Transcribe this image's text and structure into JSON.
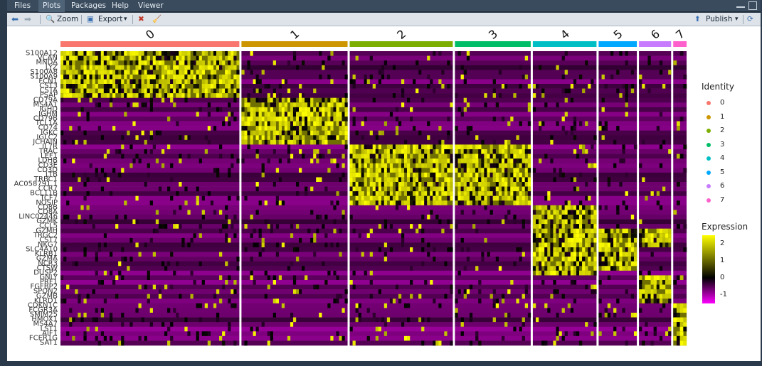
{
  "tabs": [
    {
      "label": "Files",
      "active": false
    },
    {
      "label": "Plots",
      "active": true
    },
    {
      "label": "Packages",
      "active": false
    },
    {
      "label": "Help",
      "active": false
    },
    {
      "label": "Viewer",
      "active": false
    }
  ],
  "toolbar": {
    "zoom_label": "Zoom",
    "export_label": "Export",
    "publish_label": "Publish",
    "export_dropdown": "▾",
    "publish_dropdown": "▾"
  },
  "chart_data": {
    "type": "heatmap",
    "clusters": [
      "0",
      "1",
      "2",
      "3",
      "4",
      "5",
      "6",
      "7"
    ],
    "cluster_colors": [
      "#f8766d",
      "#cd9600",
      "#7cae00",
      "#00be67",
      "#00bfc4",
      "#00a9ff",
      "#c77cff",
      "#ff61cc"
    ],
    "genes": [
      "S100A12",
      "VCAN",
      "MNDA",
      "LYZ",
      "S100A8",
      "S100A9",
      "FCN1",
      "CST3",
      "CSTA",
      "PSAP",
      "CD79A",
      "MS4A1",
      "IGHD",
      "IGHM",
      "CD79B",
      "TCL1A",
      "CD74",
      "IGKC",
      "IGLC2",
      "JCHAIN",
      "IL7R",
      "TRAC",
      "LEF1",
      "LDHB",
      "CD3E",
      "CD3D",
      "LTB",
      "TRBC1",
      "AC058791.1",
      "CCR7",
      "BCL11B",
      "TCF7",
      "NOSIP",
      "CD8B",
      "CD8A",
      "LINC02446",
      "GZMK",
      "CCL5",
      "GZMH",
      "TRGC2",
      "CST7",
      "NKG7",
      "SLC4A10",
      "KLRB1",
      "GZMA",
      "NCR3",
      "CTSW",
      "DUSP2",
      "GNLY",
      "PRF1",
      "FGFBP2",
      "SPON2",
      "GZMB",
      "KLRD1",
      "CDKN1C",
      "FCGR3A",
      "SMIM25",
      "HMOX1",
      "MS4A7",
      "LST1",
      "AIF1",
      "FCER1G",
      "SAT1"
    ],
    "gene_labels_shown": [
      "S100A12",
      "VCAN",
      "MNDA",
      "LYZ",
      "S100A8",
      "S100A9",
      "FCN1",
      "CST3",
      "CSTA",
      "PSAP",
      "CD79A",
      "MS4A1",
      "IGHD",
      "IGHM",
      "CD79B",
      "TCL1A",
      "CD74",
      "IGKC",
      "IGLC2",
      "JCHAIN",
      "IL7R",
      "TRAC",
      "LEF1",
      "LDHB",
      "CD3E",
      "CD3D",
      "LTB",
      "TRBC1",
      "AC058791.1",
      "CCR7",
      "BCL11B",
      "TCF7",
      "NOSIP",
      "CD8B",
      "CD8A",
      "LINC02446",
      "GZMK",
      "CCL5",
      "GZMH",
      "TRGC2",
      "CST7",
      "NKG7",
      "SLC4A10",
      "KLRB1",
      "GZMA",
      "NCR3",
      "CTSW",
      "DUSP2",
      "GNLY",
      "PRF1",
      "FGFBP2",
      "SPON2",
      "GZMB",
      "KLRD1",
      "CDKN1C",
      "FCGR3A",
      "SMIM25",
      "HMOX1",
      "MS4A7",
      "LST1",
      "AIF1",
      "FCER1G",
      "SAT1"
    ],
    "cluster_cell_fraction": [
      0.295,
      0.175,
      0.17,
      0.125,
      0.105,
      0.063,
      0.053,
      0.022
    ],
    "high_expression_blocks": [
      {
        "cluster": "0",
        "genes": [
          "S100A12",
          "VCAN",
          "MNDA",
          "LYZ",
          "S100A8",
          "S100A9",
          "FCN1",
          "CST3",
          "CSTA",
          "PSAP"
        ]
      },
      {
        "cluster": "1",
        "genes": [
          "CD79A",
          "MS4A1",
          "IGHD",
          "IGHM",
          "CD79B",
          "TCL1A",
          "CD74",
          "IGKC",
          "IGLC2",
          "JCHAIN"
        ]
      },
      {
        "cluster": "2",
        "genes": [
          "IL7R",
          "TRAC",
          "LEF1",
          "LDHB",
          "CD3E",
          "CD3D",
          "LTB",
          "TRBC1",
          "AC058791.1",
          "CCR7",
          "BCL11B",
          "TCF7",
          "NOSIP"
        ]
      },
      {
        "cluster": "3",
        "genes": [
          "IL7R",
          "TRAC",
          "LEF1",
          "LDHB",
          "CD3E",
          "CD3D",
          "LTB",
          "TRBC1",
          "AC058791.1",
          "CCR7",
          "BCL11B",
          "TCF7",
          "NOSIP"
        ]
      },
      {
        "cluster": "4",
        "genes": [
          "CD8B",
          "CD8A",
          "LINC02446",
          "GZMK",
          "CCL5",
          "GZMH",
          "TRGC2",
          "CST7",
          "NKG7",
          "SLC4A10",
          "KLRB1",
          "GZMA",
          "NCR3",
          "CTSW",
          "DUSP2"
        ]
      },
      {
        "cluster": "5",
        "genes": [
          "GZMH",
          "TRGC2",
          "CST7",
          "NKG7",
          "SLC4A10",
          "KLRB1",
          "GZMA",
          "NCR3",
          "CTSW"
        ]
      },
      {
        "cluster": "6",
        "genes": [
          "GZMH",
          "TRGC2",
          "CST7",
          "NKG7",
          "GNLY",
          "PRF1",
          "FGFBP2",
          "SPON2",
          "GZMB",
          "KLRD1"
        ]
      },
      {
        "cluster": "7",
        "genes": [
          "CDKN1C",
          "FCGR3A",
          "SMIM25",
          "HMOX1",
          "MS4A7",
          "LST1",
          "AIF1",
          "FCER1G",
          "SAT1"
        ]
      }
    ],
    "legend": {
      "identity_title": "Identity",
      "identity_labels": [
        "0",
        "1",
        "2",
        "3",
        "4",
        "5",
        "6",
        "7"
      ],
      "expression_title": "Expression",
      "expression_ticks": [
        "2",
        "1",
        "0",
        "-1"
      ],
      "expression_tick_values": [
        2,
        1,
        0,
        -1
      ],
      "expression_range": [
        -1.5,
        2.5
      ],
      "colormap": [
        "#ff00ff",
        "#000000",
        "#ffff00"
      ]
    }
  }
}
